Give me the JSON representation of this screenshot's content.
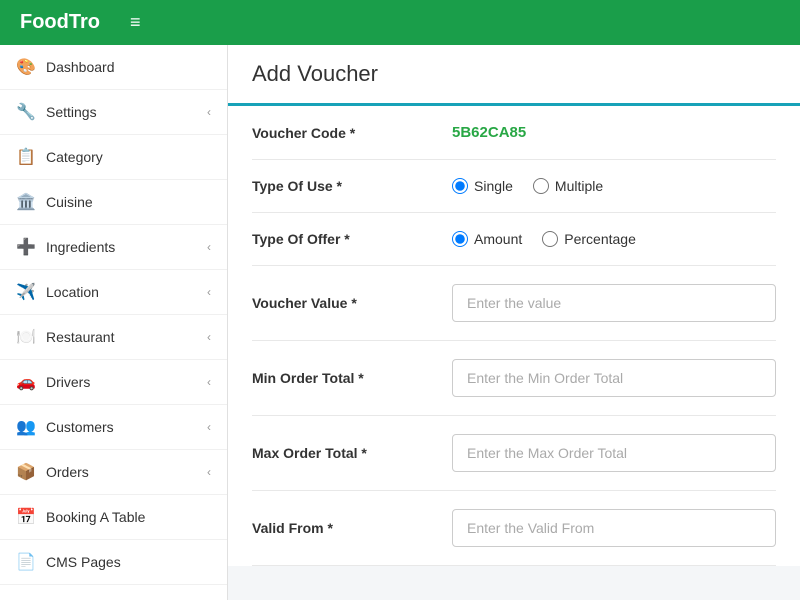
{
  "header": {
    "logo": "FoodTro",
    "hamburger": "≡"
  },
  "sidebar": {
    "items": [
      {
        "id": "dashboard",
        "icon": "🎨",
        "label": "Dashboard",
        "hasChevron": false
      },
      {
        "id": "settings",
        "icon": "🔧",
        "label": "Settings",
        "hasChevron": true
      },
      {
        "id": "category",
        "icon": "📋",
        "label": "Category",
        "hasChevron": false
      },
      {
        "id": "cuisine",
        "icon": "🏛️",
        "label": "Cuisine",
        "hasChevron": false
      },
      {
        "id": "ingredients",
        "icon": "➕",
        "label": "Ingredients",
        "hasChevron": true
      },
      {
        "id": "location",
        "icon": "✈️",
        "label": "Location",
        "hasChevron": true
      },
      {
        "id": "restaurant",
        "icon": "🍽️",
        "label": "Restaurant",
        "hasChevron": true
      },
      {
        "id": "drivers",
        "icon": "🚗",
        "label": "Drivers",
        "hasChevron": true
      },
      {
        "id": "customers",
        "icon": "👥",
        "label": "Customers",
        "hasChevron": true
      },
      {
        "id": "orders",
        "icon": "📦",
        "label": "Orders",
        "hasChevron": true
      },
      {
        "id": "booking",
        "icon": "📅",
        "label": "Booking A Table",
        "hasChevron": false
      },
      {
        "id": "cms",
        "icon": "📄",
        "label": "CMS Pages",
        "hasChevron": false
      }
    ]
  },
  "page": {
    "title": "Add Voucher"
  },
  "form": {
    "voucher_code_label": "Voucher Code *",
    "voucher_code_value": "5B62CA85",
    "type_of_use_label": "Type Of Use *",
    "type_of_use_options": [
      {
        "id": "single",
        "label": "Single",
        "checked": true
      },
      {
        "id": "multiple",
        "label": "Multiple",
        "checked": false
      }
    ],
    "type_of_offer_label": "Type Of Offer *",
    "type_of_offer_options": [
      {
        "id": "amount",
        "label": "Amount",
        "checked": true
      },
      {
        "id": "percentage",
        "label": "Percentage",
        "checked": false
      }
    ],
    "voucher_value_label": "Voucher Value *",
    "voucher_value_placeholder": "Enter the value",
    "min_order_label": "Min Order Total *",
    "min_order_placeholder": "Enter the Min Order Total",
    "max_order_label": "Max Order Total *",
    "max_order_placeholder": "Enter the Max Order Total",
    "valid_from_label": "Valid From *",
    "valid_from_placeholder": "Enter the Valid From"
  }
}
